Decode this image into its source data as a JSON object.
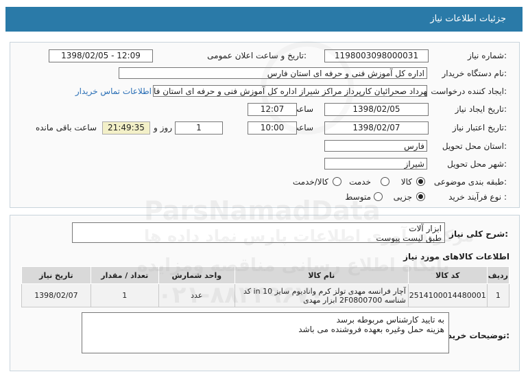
{
  "header": {
    "title": "جزئیات اطلاعات نیاز"
  },
  "fields": {
    "need_number_label": "شماره نیاز:",
    "need_number": "1198003098000031",
    "announce_label": "تاریخ و ساعت اعلان عمومی:",
    "announce_value": "1398/02/05 - 12:09",
    "buyer_label": "نام دستگاه خریدار:",
    "buyer_value": "اداره کل آموزش فنی و حرفه ای استان فارس",
    "requester_label": "ایجاد کننده درخواست:",
    "requester_value": "مهرداد صحرائیان کارپرداز مراکز  شیراز اداره کل آموزش فنی و حرفه ای استان فا",
    "contact_link": "اطلاعات تماس خریدار",
    "created_label": "تاریخ ایجاد نیاز:",
    "created_date": "1398/02/05",
    "hour_label": "ساعت",
    "created_time": "12:07",
    "valid_label": "تاریخ اعتبار نیاز:",
    "valid_date": "1398/02/07",
    "valid_time": "10:00",
    "days_value": "1",
    "days_label": "روز و",
    "remaining_time": "21:49:35",
    "remaining_label": "ساعت باقی مانده",
    "province_label": "استان محل تحویل:",
    "province_value": "فارس",
    "city_label": "شهر محل تحویل:",
    "city_value": "شیراز",
    "category_label": "طبقه بندی موضوعی:",
    "cat_goods": "کالا",
    "cat_service": "خدمت",
    "cat_both": "کالا/خدمت",
    "process_label": "نوع فرآیند خرید :",
    "proc_partial": "جزیی",
    "proc_medium": "متوسط"
  },
  "summary": {
    "label": "شرح کلی نیاز:",
    "line1": "ابزار آلات",
    "line2": "طبق لیست پیوست"
  },
  "items_title": "اطلاعات کالاهای مورد نیاز",
  "table": {
    "headers": [
      "ردیف",
      "کد کالا",
      "نام کالا",
      "واحد شمارش",
      "تعداد / مقدار",
      "تاریخ نیاز"
    ],
    "rows": [
      {
        "row": "1",
        "code": "2514100014480001",
        "name": "آچار فرانسه مهدی تولز کرم وانادیوم سایز 10 in کد شناسه 2F0800700 ابزار مهدی",
        "unit": "عدد",
        "qty": "1",
        "date": "1398/02/07"
      }
    ]
  },
  "buyer_notes": {
    "label": "توضیحات خریدار:",
    "line1": "به تایید کارشناس مربوطه برسد",
    "line2": "هزینه حمل وغیره بعهده فروشنده می باشد"
  },
  "watermark": {
    "brand": "ParsNamadData",
    "line_a": "مرکز فرآوری اطلاعات پارس نماد داده ها",
    "line_b": "پایگاه اطلاع رسانی مناقصه ومزایده",
    "phone": "۰۲۱-۸۸۳۴۹۶۷۰"
  },
  "colors": {
    "header_bg": "#2a7aa8",
    "link": "#2a6fb6",
    "remaining_bg": "#f3f0c8"
  }
}
